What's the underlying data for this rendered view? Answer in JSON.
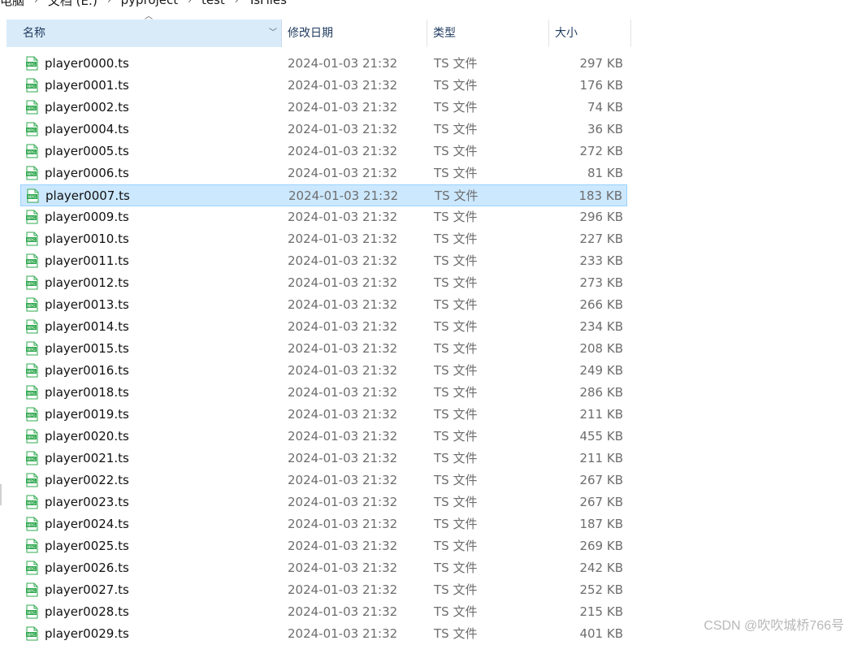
{
  "breadcrumb": [
    "电脑",
    "文档 (E:)",
    "pyproject",
    "test",
    "TsFiles"
  ],
  "columns": {
    "name": "名称",
    "date": "修改日期",
    "type": "类型",
    "size": "大小"
  },
  "files": [
    {
      "name": "player0000.ts",
      "date": "2024-01-03 21:32",
      "type": "TS 文件",
      "size": "297 KB"
    },
    {
      "name": "player0001.ts",
      "date": "2024-01-03 21:32",
      "type": "TS 文件",
      "size": "176 KB"
    },
    {
      "name": "player0002.ts",
      "date": "2024-01-03 21:32",
      "type": "TS 文件",
      "size": "74 KB"
    },
    {
      "name": "player0004.ts",
      "date": "2024-01-03 21:32",
      "type": "TS 文件",
      "size": "36 KB"
    },
    {
      "name": "player0005.ts",
      "date": "2024-01-03 21:32",
      "type": "TS 文件",
      "size": "272 KB"
    },
    {
      "name": "player0006.ts",
      "date": "2024-01-03 21:32",
      "type": "TS 文件",
      "size": "81 KB"
    },
    {
      "name": "player0007.ts",
      "date": "2024-01-03 21:32",
      "type": "TS 文件",
      "size": "183 KB",
      "selected": true
    },
    {
      "name": "player0009.ts",
      "date": "2024-01-03 21:32",
      "type": "TS 文件",
      "size": "296 KB"
    },
    {
      "name": "player0010.ts",
      "date": "2024-01-03 21:32",
      "type": "TS 文件",
      "size": "227 KB"
    },
    {
      "name": "player0011.ts",
      "date": "2024-01-03 21:32",
      "type": "TS 文件",
      "size": "233 KB"
    },
    {
      "name": "player0012.ts",
      "date": "2024-01-03 21:32",
      "type": "TS 文件",
      "size": "273 KB"
    },
    {
      "name": "player0013.ts",
      "date": "2024-01-03 21:32",
      "type": "TS 文件",
      "size": "266 KB"
    },
    {
      "name": "player0014.ts",
      "date": "2024-01-03 21:32",
      "type": "TS 文件",
      "size": "234 KB"
    },
    {
      "name": "player0015.ts",
      "date": "2024-01-03 21:32",
      "type": "TS 文件",
      "size": "208 KB"
    },
    {
      "name": "player0016.ts",
      "date": "2024-01-03 21:32",
      "type": "TS 文件",
      "size": "249 KB"
    },
    {
      "name": "player0018.ts",
      "date": "2024-01-03 21:32",
      "type": "TS 文件",
      "size": "286 KB"
    },
    {
      "name": "player0019.ts",
      "date": "2024-01-03 21:32",
      "type": "TS 文件",
      "size": "211 KB"
    },
    {
      "name": "player0020.ts",
      "date": "2024-01-03 21:32",
      "type": "TS 文件",
      "size": "455 KB"
    },
    {
      "name": "player0021.ts",
      "date": "2024-01-03 21:32",
      "type": "TS 文件",
      "size": "211 KB"
    },
    {
      "name": "player0022.ts",
      "date": "2024-01-03 21:32",
      "type": "TS 文件",
      "size": "267 KB"
    },
    {
      "name": "player0023.ts",
      "date": "2024-01-03 21:32",
      "type": "TS 文件",
      "size": "267 KB"
    },
    {
      "name": "player0024.ts",
      "date": "2024-01-03 21:32",
      "type": "TS 文件",
      "size": "187 KB"
    },
    {
      "name": "player0025.ts",
      "date": "2024-01-03 21:32",
      "type": "TS 文件",
      "size": "269 KB"
    },
    {
      "name": "player0026.ts",
      "date": "2024-01-03 21:32",
      "type": "TS 文件",
      "size": "242 KB"
    },
    {
      "name": "player0027.ts",
      "date": "2024-01-03 21:32",
      "type": "TS 文件",
      "size": "252 KB"
    },
    {
      "name": "player0028.ts",
      "date": "2024-01-03 21:32",
      "type": "TS 文件",
      "size": "215 KB"
    },
    {
      "name": "player0029.ts",
      "date": "2024-01-03 21:32",
      "type": "TS 文件",
      "size": "401 KB"
    }
  ],
  "file_icon": "mpg-video-file-icon",
  "colors": {
    "header_active_bg": "#d9ebf9",
    "selected_row_bg": "#cce8ff",
    "selected_row_border": "#99d1ff",
    "file_icon_green": "#2fa84f"
  },
  "watermark": "CSDN @吹吹城桥766号"
}
